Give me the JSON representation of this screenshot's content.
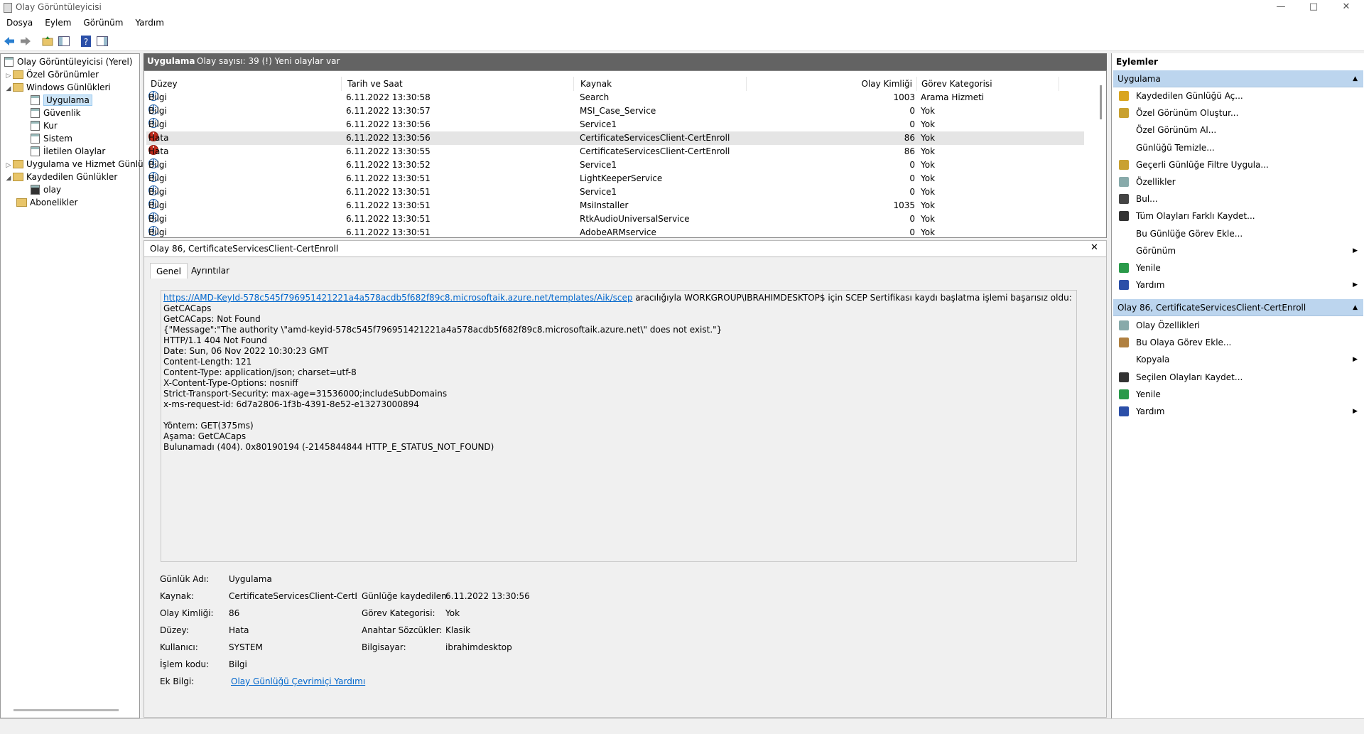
{
  "window": {
    "title": "Olay Görüntüleyicisi",
    "minimize": "—",
    "maximize": "□",
    "close": "✕"
  },
  "menu": [
    "Dosya",
    "Eylem",
    "Görünüm",
    "Yardım"
  ],
  "tree": {
    "root": "Olay Görüntüleyicisi (Yerel)",
    "custom_views": "Özel Görünümler",
    "windows_logs": "Windows Günlükleri",
    "application": "Uygulama",
    "security": "Güvenlik",
    "setup": "Kur",
    "system": "Sistem",
    "forwarded": "İletilen Olaylar",
    "app_service": "Uygulama ve Hizmet Günlük",
    "saved_logs": "Kaydedilen Günlükler",
    "olay": "olay",
    "subscriptions": "Abonelikler"
  },
  "list": {
    "title": "Uygulama",
    "count": "Olay sayısı: 39 (!) Yeni olaylar var",
    "columns": [
      "Düzey",
      "Tarih ve Saat",
      "Kaynak",
      "Olay Kimliği",
      "Görev Kategorisi"
    ],
    "rows": [
      {
        "level": "Bilgi",
        "date": "6.11.2022 13:30:58",
        "source": "Search",
        "id": "1003",
        "cat": "Arama Hizmeti"
      },
      {
        "level": "Bilgi",
        "date": "6.11.2022 13:30:57",
        "source": "MSI_Case_Service",
        "id": "0",
        "cat": "Yok"
      },
      {
        "level": "Bilgi",
        "date": "6.11.2022 13:30:56",
        "source": "Service1",
        "id": "0",
        "cat": "Yok"
      },
      {
        "level": "Hata",
        "date": "6.11.2022 13:30:56",
        "source": "CertificateServicesClient-CertEnroll",
        "id": "86",
        "cat": "Yok"
      },
      {
        "level": "Hata",
        "date": "6.11.2022 13:30:55",
        "source": "CertificateServicesClient-CertEnroll",
        "id": "86",
        "cat": "Yok"
      },
      {
        "level": "Bilgi",
        "date": "6.11.2022 13:30:52",
        "source": "Service1",
        "id": "0",
        "cat": "Yok"
      },
      {
        "level": "Bilgi",
        "date": "6.11.2022 13:30:51",
        "source": "LightKeeperService",
        "id": "0",
        "cat": "Yok"
      },
      {
        "level": "Bilgi",
        "date": "6.11.2022 13:30:51",
        "source": "Service1",
        "id": "0",
        "cat": "Yok"
      },
      {
        "level": "Bilgi",
        "date": "6.11.2022 13:30:51",
        "source": "MsiInstaller",
        "id": "1035",
        "cat": "Yok"
      },
      {
        "level": "Bilgi",
        "date": "6.11.2022 13:30:51",
        "source": "RtkAudioUniversalService",
        "id": "0",
        "cat": "Yok"
      },
      {
        "level": "Bilgi",
        "date": "6.11.2022 13:30:51",
        "source": "AdobeARMservice",
        "id": "0",
        "cat": "Yok"
      }
    ]
  },
  "detail": {
    "title": "Olay 86, CertificateServicesClient-CertEnroll",
    "close": "✕",
    "tabs": [
      "Genel",
      "Ayrıntılar"
    ],
    "link": "https://AMD-KeyId-578c545f796951421221a4a578acdb5f682f89c8.microsoftaik.azure.net/templates/Aik/scep",
    "link_suffix": " aracılığıyla WORKGROUP\\IBRAHIMDESKTOP$ için SCEP Sertifikası kaydı başlatma işlemi başarısız oldu:",
    "body": "\nGetCACaps\nGetCACaps: Not Found\n{\"Message\":\"The authority \\\"amd-keyid-578c545f796951421221a4a578acdb5f682f89c8.microsoftaik.azure.net\\\" does not exist.\"}\nHTTP/1.1 404 Not Found\nDate: Sun, 06 Nov 2022 10:30:23 GMT\nContent-Length: 121\nContent-Type: application/json; charset=utf-8\nX-Content-Type-Options: nosniff\nStrict-Transport-Security: max-age=31536000;includeSubDomains\nx-ms-request-id: 6d7a2806-1f3b-4391-8e52-e13273000894\n\nYöntem: GET(375ms)\nAşama: GetCACaps\nBulunamadı (404). 0x80190194 (-2145844844 HTTP_E_STATUS_NOT_FOUND)",
    "fields": {
      "log_name_l": "Günlük Adı:",
      "log_name": "Uygulama",
      "source_l": "Kaynak:",
      "source": "CertificateServicesClient-CertEnro",
      "logged_l": "Günlüğe kaydedilen:",
      "logged": "6.11.2022 13:30:56",
      "event_id_l": "Olay Kimliği:",
      "event_id": "86",
      "task_l": "Görev Kategorisi:",
      "task": "Yok",
      "level_l": "Düzey:",
      "level": "Hata",
      "keywords_l": "Anahtar Sözcükler:",
      "keywords": "Klasik",
      "user_l": "Kullanıcı:",
      "user": "SYSTEM",
      "computer_l": "Bilgisayar:",
      "computer": "ibrahimdesktop",
      "opcode_l": "İşlem kodu:",
      "opcode": "Bilgi",
      "more_l": "Ek Bilgi:",
      "more": "Olay Günlüğü Çevrimiçi Yardımı"
    }
  },
  "actions": {
    "title": "Eylemler",
    "section1": "Uygulama",
    "items1": [
      "Kaydedilen Günlüğü Aç...",
      "Özel Görünüm Oluştur...",
      "Özel Görünüm Al...",
      "Günlüğü Temizle...",
      "Geçerli Günlüğe Filtre Uygula...",
      "Özellikler",
      "Bul...",
      "Tüm Olayları Farklı Kaydet...",
      "Bu Günlüğe Görev Ekle...",
      "Görünüm",
      "Yenile",
      "Yardım"
    ],
    "section2": "Olay 86, CertificateServicesClient-CertEnroll",
    "items2": [
      "Olay Özellikleri",
      "Bu Olaya Görev Ekle...",
      "Kopyala",
      "Seçilen Olayları Kaydet...",
      "Yenile",
      "Yardım"
    ]
  },
  "colors": {
    "accent": "#bcd5ee",
    "header_dark": "#636363",
    "error": "#c42b1c",
    "info": "#1d5fa8",
    "link": "#0066cc"
  }
}
